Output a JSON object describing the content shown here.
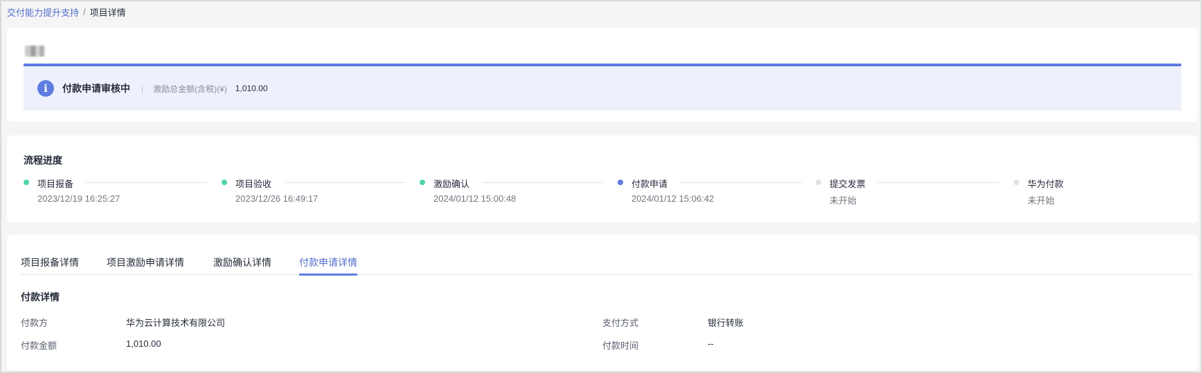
{
  "breadcrumb": {
    "parent": "交付能力提升支持",
    "separator": "/",
    "current": "项目详情"
  },
  "header": {
    "status_icon": "info-icon",
    "status_icon_glyph": "i",
    "status_title": "付款申请审核中",
    "divider": "|",
    "amount_label": "激励总金额(含税)(¥)",
    "amount_value": "1,010.00"
  },
  "progress": {
    "title": "流程进度",
    "steps": [
      {
        "name": "项目报备",
        "time": "2023/12/19 16:25:27",
        "state": "done"
      },
      {
        "name": "项目验收",
        "time": "2023/12/26 16:49:17",
        "state": "done"
      },
      {
        "name": "激励确认",
        "time": "2024/01/12 15:00:48",
        "state": "done"
      },
      {
        "name": "付款申请",
        "time": "2024/01/12 15:06:42",
        "state": "current"
      },
      {
        "name": "提交发票",
        "time": "未开始",
        "state": "pending"
      },
      {
        "name": "华为付款",
        "time": "未开始",
        "state": "pending"
      }
    ]
  },
  "tabs": [
    {
      "label": "项目报备详情",
      "active": false
    },
    {
      "label": "项目激励申请详情",
      "active": false
    },
    {
      "label": "激励确认详情",
      "active": false
    },
    {
      "label": "付款申请详情",
      "active": true
    }
  ],
  "payment": {
    "title": "付款详情",
    "payer_label": "付款方",
    "payer_value": "华为云计算技术有限公司",
    "method_label": "支付方式",
    "method_value": "银行转账",
    "amount_label": "付款金额",
    "amount_value": "1,010.00",
    "time_label": "付款时间",
    "time_value": "--"
  },
  "colors": {
    "done": "#50d4ab",
    "current": "#5e7ce0",
    "pending": "#dfe1e6",
    "accent": "#526ecc"
  }
}
